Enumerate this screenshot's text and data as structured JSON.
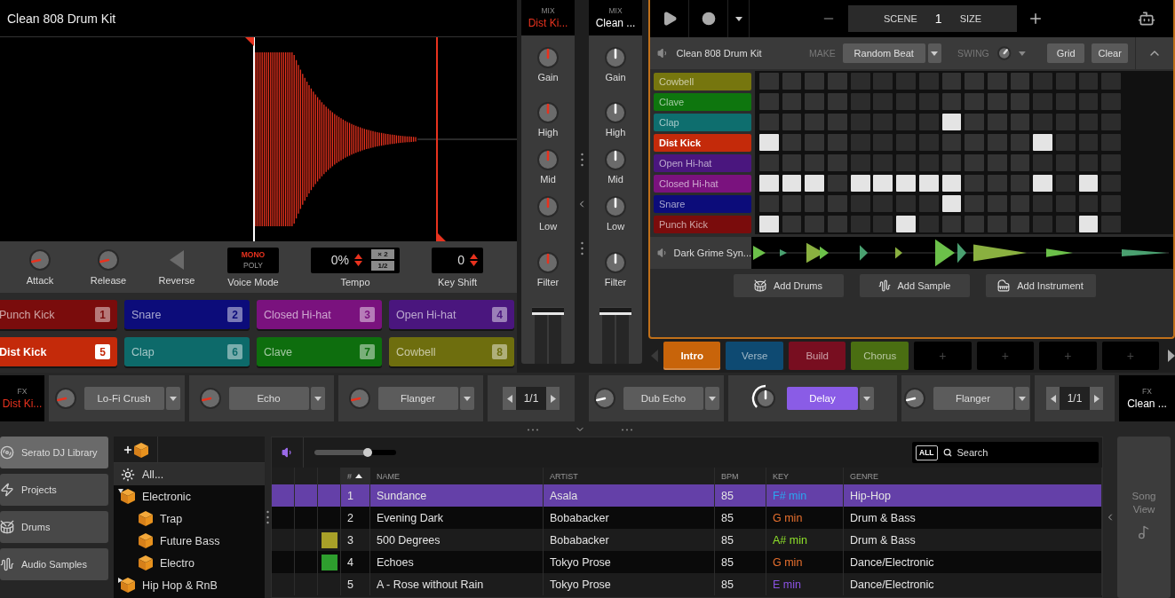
{
  "deck": {
    "title": "Clean 808 Drum Kit",
    "controls": {
      "attack": {
        "label": "Attack"
      },
      "release": {
        "label": "Release"
      },
      "reverse": {
        "label": "Reverse"
      },
      "voice_mode": {
        "label": "Voice Mode",
        "options": [
          {
            "label": "MONO",
            "selected": true
          },
          {
            "label": "POLY",
            "selected": false
          }
        ]
      },
      "tempo": {
        "label": "Tempo",
        "value": "0%",
        "buttons": [
          "× 2",
          "1/2"
        ]
      },
      "key_shift": {
        "label": "Key Shift",
        "value": "0"
      }
    },
    "pads": [
      {
        "name": "Punch Kick",
        "number": "1",
        "color": "#7a0c0c",
        "selected": false
      },
      {
        "name": "Snare",
        "number": "2",
        "color": "#0c0c7a",
        "selected": false
      },
      {
        "name": "Closed Hi-hat",
        "number": "3",
        "color": "#7a127e",
        "selected": false
      },
      {
        "name": "Open Hi-hat",
        "number": "4",
        "color": "#4a167e",
        "selected": false
      },
      {
        "name": "Dist Kick",
        "number": "5",
        "color": "#c42a0a",
        "selected": true
      },
      {
        "name": "Clap",
        "number": "6",
        "color": "#0d6a6a",
        "selected": false
      },
      {
        "name": "Clave",
        "number": "7",
        "color": "#0e6e0e",
        "selected": false
      },
      {
        "name": "Cowbell",
        "number": "8",
        "color": "#6e6e0e",
        "selected": false
      }
    ]
  },
  "mixer": {
    "channels": [
      {
        "label": "MIX",
        "name": "Dist Ki...",
        "color": "#e8321e",
        "knobs": [
          {
            "label": "Gain"
          },
          {
            "label": "High"
          },
          {
            "label": "Mid"
          },
          {
            "label": "Low"
          },
          {
            "label": "Filter"
          }
        ]
      },
      {
        "label": "MIX",
        "name": "Clean ...",
        "color": "#ffffff",
        "knobs": [
          {
            "label": "Gain"
          },
          {
            "label": "High"
          },
          {
            "label": "Mid"
          },
          {
            "label": "Low"
          },
          {
            "label": "Filter"
          }
        ]
      }
    ]
  },
  "sequencer": {
    "scene": {
      "label": "SCENE",
      "value": "1",
      "size_label": "SIZE"
    },
    "kit": "Clean 808 Drum Kit",
    "make_label": "MAKE",
    "make_button": "Random Beat",
    "swing": {
      "label": "SWING"
    },
    "buttons": [
      "Grid",
      "Clear"
    ],
    "tracks": [
      {
        "name": "Cowbell",
        "color": "#76760e",
        "selected": false,
        "steps": [
          false,
          false,
          false,
          false,
          false,
          false,
          false,
          false,
          false,
          false,
          false,
          false,
          false,
          false,
          false,
          false
        ]
      },
      {
        "name": "Clave",
        "color": "#0e760e",
        "selected": false,
        "steps": [
          false,
          false,
          false,
          false,
          false,
          false,
          false,
          false,
          false,
          false,
          false,
          false,
          false,
          false,
          false,
          false
        ]
      },
      {
        "name": "Clap",
        "color": "#0e6e6e",
        "selected": false,
        "steps": [
          false,
          false,
          false,
          false,
          false,
          false,
          false,
          false,
          true,
          false,
          false,
          false,
          false,
          false,
          false,
          false
        ]
      },
      {
        "name": "Dist Kick",
        "color": "#c42a0a",
        "selected": true,
        "steps": [
          true,
          false,
          false,
          false,
          false,
          false,
          false,
          false,
          false,
          false,
          false,
          false,
          true,
          false,
          false,
          false
        ]
      },
      {
        "name": "Open Hi-hat",
        "color": "#4a167e",
        "selected": false,
        "steps": [
          false,
          false,
          false,
          false,
          false,
          false,
          false,
          false,
          false,
          false,
          false,
          false,
          false,
          false,
          false,
          false
        ]
      },
      {
        "name": "Closed Hi-hat",
        "color": "#7a127e",
        "selected": false,
        "steps": [
          true,
          true,
          true,
          false,
          true,
          true,
          true,
          true,
          true,
          false,
          false,
          false,
          true,
          false,
          true,
          false
        ]
      },
      {
        "name": "Snare",
        "color": "#0c0c7a",
        "selected": false,
        "steps": [
          false,
          false,
          false,
          false,
          false,
          false,
          false,
          false,
          true,
          false,
          false,
          false,
          false,
          false,
          false,
          false
        ]
      },
      {
        "name": "Punch Kick",
        "color": "#7a0c0c",
        "selected": false,
        "steps": [
          true,
          false,
          false,
          false,
          false,
          false,
          true,
          false,
          false,
          false,
          false,
          false,
          false,
          false,
          true,
          false
        ]
      }
    ],
    "audio_track": {
      "name": "Dark Grime Syn..."
    },
    "add_buttons": [
      {
        "label": "Add Drums",
        "kind": "drums"
      },
      {
        "label": "Add Sample",
        "kind": "sample"
      },
      {
        "label": "Add Instrument",
        "kind": "instrument"
      }
    ]
  },
  "scenes": [
    {
      "kind": "scene",
      "label": "Intro",
      "color": "#c8640a",
      "selected": true
    },
    {
      "kind": "scene",
      "label": "Verse",
      "color": "#0e4a72",
      "selected": false
    },
    {
      "kind": "scene",
      "label": "Build",
      "color": "#780e20",
      "selected": false
    },
    {
      "kind": "scene",
      "label": "Chorus",
      "color": "#4a6e12",
      "selected": false
    },
    {
      "kind": "empty",
      "label": "+",
      "selected": false
    },
    {
      "kind": "empty",
      "label": "+",
      "selected": false
    },
    {
      "kind": "empty",
      "label": "+",
      "selected": false
    },
    {
      "kind": "empty",
      "label": "+",
      "selected": false
    }
  ],
  "fx": [
    {
      "label": "FX",
      "deck": "Dist Ki...",
      "color": "#e8321e",
      "page": "1/1",
      "units": [
        {
          "name": "Lo-Fi Crush",
          "on": false
        },
        {
          "name": "Echo",
          "on": false
        },
        {
          "name": "Flanger",
          "on": false
        }
      ]
    },
    {
      "label": "FX",
      "deck": "Clean ...",
      "color": "#ffffff",
      "page": "1/1",
      "units": [
        {
          "name": "Dub Echo",
          "on": false
        },
        {
          "name": "Delay",
          "on": true
        },
        {
          "name": "Flanger",
          "on": false
        }
      ]
    }
  ],
  "library": {
    "sidebar": [
      {
        "label": "Serato DJ Library",
        "kind": "library",
        "selected": true
      },
      {
        "label": "Projects",
        "kind": "projects",
        "selected": false
      },
      {
        "label": "Drums",
        "kind": "drums",
        "selected": false
      },
      {
        "label": "Audio Samples",
        "kind": "samples",
        "selected": false
      }
    ],
    "crates": [
      {
        "label": "All...",
        "kind": "all",
        "selected": true
      },
      {
        "label": "Electronic",
        "kind": "crate",
        "selected": false,
        "expanded": true,
        "children": [
          {
            "label": "Trap",
            "kind": "crate",
            "selected": false
          },
          {
            "label": "Future Bass",
            "kind": "crate",
            "selected": false
          },
          {
            "label": "Electro",
            "kind": "crate",
            "selected": false
          }
        ]
      },
      {
        "label": "Hip Hop & RnB",
        "kind": "crate",
        "selected": false,
        "expanded": false
      }
    ],
    "preview": {
      "level": 0.65
    },
    "search": {
      "filter": "ALL",
      "placeholder": "Search"
    },
    "columns": [
      {
        "label": "#",
        "sorted": true
      },
      {
        "label": "NAME",
        "sorted": false
      },
      {
        "label": "ARTIST",
        "sorted": false
      },
      {
        "label": "BPM",
        "sorted": false
      },
      {
        "label": "KEY",
        "sorted": false
      },
      {
        "label": "GENRE",
        "sorted": false
      }
    ],
    "rows": [
      {
        "number": "1",
        "name": "Sundance",
        "artist": "Asala",
        "bpm": "85",
        "key": {
          "label": "F# min",
          "color": "#2aa8f2"
        },
        "genre": "Hip-Hop",
        "selected": true
      },
      {
        "number": "2",
        "name": "Evening Dark",
        "artist": "Bobabacker",
        "bpm": "85",
        "key": {
          "label": "G min",
          "color": "#e8702e"
        },
        "genre": "Drum & Bass",
        "selected": false
      },
      {
        "number": "3",
        "name": "500 Degrees",
        "artist": "Bobabacker",
        "bpm": "85",
        "key": {
          "label": "A# min",
          "color": "#8ee02a"
        },
        "genre": "Drum & Bass",
        "selected": false,
        "color": "#a8a028"
      },
      {
        "number": "4",
        "name": "Echoes",
        "artist": "Tokyo Prose",
        "bpm": "85",
        "key": {
          "label": "G min",
          "color": "#e8702e"
        },
        "genre": "Dance/Electronic",
        "selected": false,
        "color": "#2e9e2e"
      },
      {
        "number": "5",
        "name": "A - Rose without Rain",
        "artist": "Tokyo Prose",
        "bpm": "85",
        "key": {
          "label": "E min",
          "color": "#8a52e2"
        },
        "genre": "Dance/Electronic",
        "selected": false
      }
    ],
    "song_view": {
      "label": "Song View"
    }
  }
}
